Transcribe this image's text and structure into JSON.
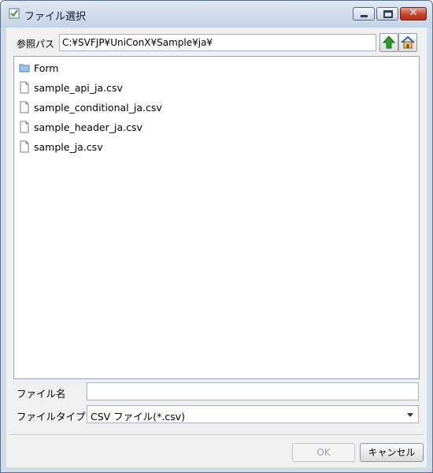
{
  "window": {
    "title": "ファイル選択",
    "controls": {
      "minimize": "minimize",
      "maximize": "maximize",
      "close": "✕"
    }
  },
  "path_bar": {
    "label": "参照パス",
    "value": "C:¥SVFJP¥UniConX¥Sample¥ja¥",
    "up_icon": "up-arrow-icon",
    "home_icon": "home-icon"
  },
  "files": [
    {
      "name": "Form",
      "type": "folder"
    },
    {
      "name": "sample_api_ja.csv",
      "type": "file"
    },
    {
      "name": "sample_conditional_ja.csv",
      "type": "file"
    },
    {
      "name": "sample_header_ja.csv",
      "type": "file"
    },
    {
      "name": "sample_ja.csv",
      "type": "file"
    }
  ],
  "filename": {
    "label": "ファイル名",
    "value": ""
  },
  "filetype": {
    "label": "ファイルタイプ",
    "selected": "CSV ファイル(*.csv)"
  },
  "buttons": {
    "ok": "OK",
    "cancel": "キャンセル"
  },
  "colors": {
    "up_arrow": "#2e9b2e",
    "home": "#2b63b8",
    "close_button": "#c4402a"
  }
}
